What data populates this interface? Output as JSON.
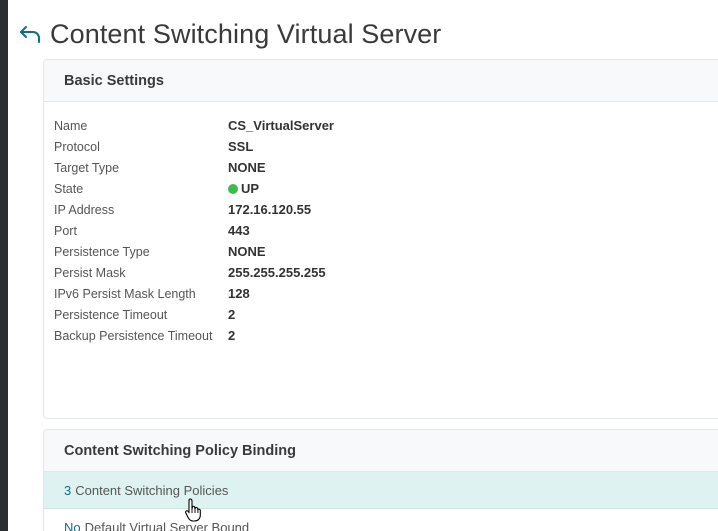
{
  "header": {
    "title": "Content Switching Virtual Server",
    "back_icon": "back-arrow-icon"
  },
  "basic_settings": {
    "title": "Basic Settings",
    "properties": [
      {
        "label": "Name",
        "value": "CS_VirtualServer"
      },
      {
        "label": "Protocol",
        "value": "SSL"
      },
      {
        "label": "Target Type",
        "value": "NONE"
      },
      {
        "label": "State",
        "value": "UP"
      },
      {
        "label": "IP Address",
        "value": "172.16.120.55"
      },
      {
        "label": "Port",
        "value": "443"
      },
      {
        "label": "Persistence Type",
        "value": "NONE"
      },
      {
        "label": "Persist Mask",
        "value": "255.255.255.255"
      },
      {
        "label": "IPv6 Persist Mask Length",
        "value": "128"
      },
      {
        "label": "Persistence Timeout",
        "value": "2"
      },
      {
        "label": "Backup Persistence Timeout",
        "value": "2"
      }
    ],
    "state_color": "#3dbb4d"
  },
  "policy_binding": {
    "title": "Content Switching Policy Binding",
    "rows": [
      {
        "count": "3",
        "text": "Content Switching Policies"
      },
      {
        "count": "No",
        "text": "Default Virtual Server Bound"
      }
    ]
  },
  "colors": {
    "accent": "#0f6e87",
    "highlight_row": "#dff2f2"
  }
}
